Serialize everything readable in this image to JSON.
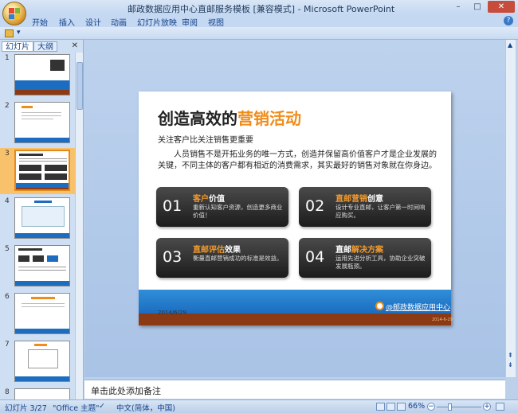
{
  "window": {
    "title": "邮政数据应用中心直邮服务模板 [兼容模式] - Microsoft PowerPoint",
    "min": "–",
    "max": "□",
    "close": "✕"
  },
  "ribbon": {
    "tabs": [
      "开始",
      "插入",
      "设计",
      "动画",
      "幻灯片放映",
      "审阅",
      "视图"
    ],
    "help": "?"
  },
  "panel": {
    "tabs": [
      "幻灯片",
      "大纲"
    ],
    "close": "✕",
    "slide_numbers": [
      "1",
      "2",
      "3",
      "4",
      "5",
      "6",
      "7",
      "8"
    ]
  },
  "slide": {
    "title_main": "创造高效的",
    "title_highlight": "营销活动",
    "subtitle": "关注客户比关注销售更重要",
    "body": "人员销售不是开拓业务的唯一方式，创造并保留高价值客户才是企业发展的关键，不同主体的客户都有相近的消费需求，其实最好的销售对象就在你身边。",
    "cards": [
      {
        "num": "01",
        "title_o": "客户",
        "title_w": "价值",
        "text": "重新认知客户资源，创造更多商业价值！"
      },
      {
        "num": "02",
        "title_o": "直邮营销",
        "title_w": "创意",
        "text": "设计专业直邮，让客户第一时间响应购买。"
      },
      {
        "num": "03",
        "title_o": "直邮评估",
        "title_w": "效果",
        "text": "衡量直邮营销成功的标准是效益。"
      },
      {
        "num": "04",
        "title_o": "直邮",
        "title_w": "解决方案",
        "text": "运用先进分析工具，协助企业突破发展瓶颈。"
      }
    ],
    "date": "2014/6/29",
    "brand": "@邮政数据应用中心",
    "tiny": "2014-6-29"
  },
  "notes": {
    "placeholder": "单击此处添加备注"
  },
  "status": {
    "slide_count": "幻灯片 3/27",
    "theme": "\"Office 主题\"",
    "language": "中文(简体，中国)",
    "zoom": "66%"
  },
  "colors": {
    "accent_orange": "#f08c1a",
    "slide_blue": "#1c6cbf",
    "slide_brown": "#8b3a14"
  }
}
